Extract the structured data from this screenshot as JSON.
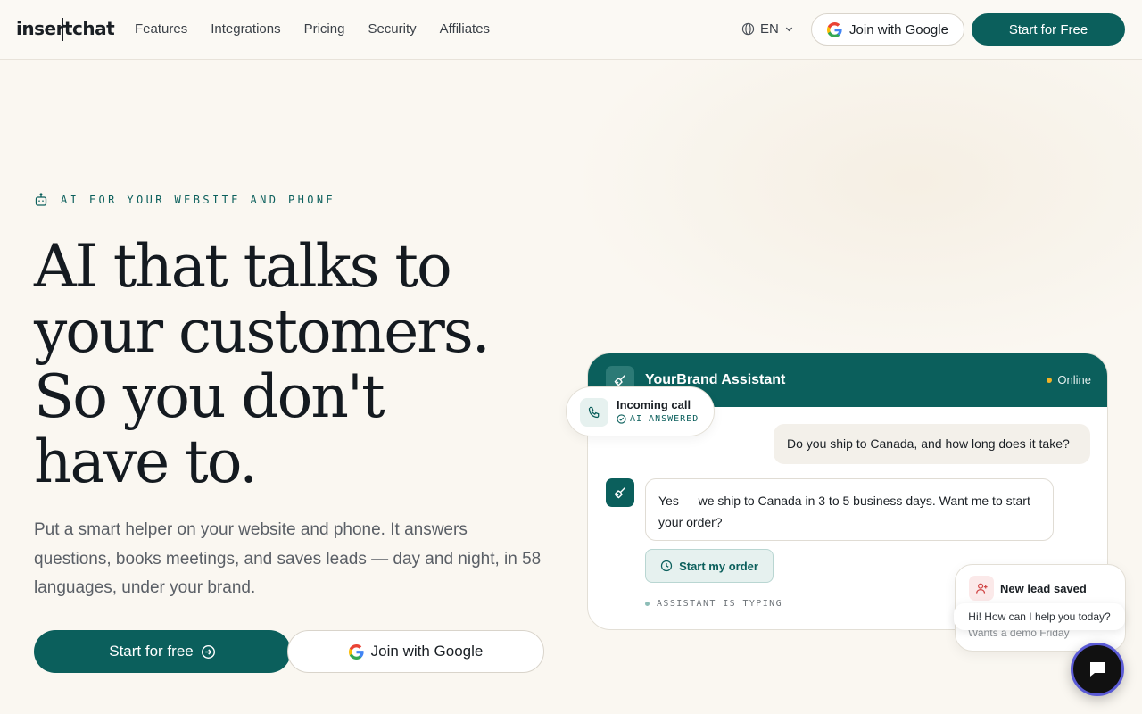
{
  "nav": {
    "logo": "insertchat",
    "links": [
      "Features",
      "Integrations",
      "Pricing",
      "Security",
      "Affiliates"
    ],
    "language": "EN",
    "google_button": "Join with Google",
    "start_button": "Start for Free"
  },
  "hero": {
    "eyebrow": "AI FOR YOUR WEBSITE AND PHONE",
    "headline_lines": [
      "AI that talks to",
      "your customers.",
      "So you don't",
      "have to."
    ],
    "subtext": "Put a smart helper on your website and phone. It answers questions, books meetings, and saves leads — day and night, in 58 languages, under your brand.",
    "start_button": "Start for free",
    "google_button": "Join with Google"
  },
  "chat": {
    "assistant_name": "YourBrand Assistant",
    "status": "Online",
    "user_message": "Do you ship to Canada, and how long does it take?",
    "bot_message": "Yes — we ship to Canada in 3 to 5 business days. Want me to start your order?",
    "action_chip": "Start my order",
    "typing": "ASSISTANT IS TYPING"
  },
  "call_chip": {
    "title": "Incoming call",
    "subtitle": "AI ANSWERED"
  },
  "lead_card": {
    "title": "New lead saved",
    "subtitle": "Wants a demo Friday"
  },
  "widget": {
    "popup": "Hi! How can I help you today?"
  },
  "colors": {
    "brand": "#0b5f5c",
    "background": "#faf7f1",
    "online_dot": "#f2b227"
  }
}
